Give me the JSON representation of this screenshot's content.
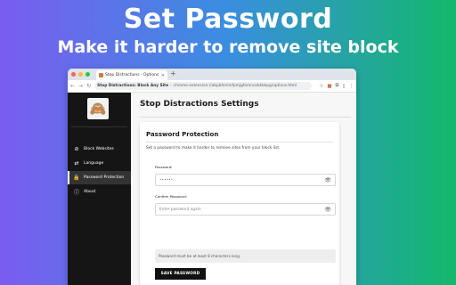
{
  "hero": {
    "title": "Set Password",
    "subtitle": "Make it harder to remove site block"
  },
  "browser": {
    "tab_title": "Stop Distractions - Options",
    "tab_close": "×",
    "new_tab": "+",
    "back": "←",
    "forward": "→",
    "reload": "↻",
    "site_name": "Stop Distractions: Block Any Site",
    "url": "chrome-extension://abpbhimlnfpmjgfomncebkbkpg/options.html",
    "colors": {
      "close": "#ff5f57",
      "minimize": "#febc2e",
      "maximize": "#28c840"
    }
  },
  "sidebar": {
    "logo": "🙈",
    "items": [
      {
        "label": "Block Websites",
        "icon": "⊘",
        "icon_name": "block-icon"
      },
      {
        "label": "Language",
        "icon": "⇄",
        "icon_name": "language-icon"
      },
      {
        "label": "Password Protection",
        "icon": "🔒",
        "icon_name": "lock-icon",
        "active": true
      },
      {
        "label": "About",
        "icon": "ⓘ",
        "icon_name": "info-icon"
      }
    ]
  },
  "main": {
    "page_title": "Stop Distractions Settings",
    "card": {
      "title": "Password Protection",
      "description": "Set a password to make it harder to remove sites from your block list.",
      "password_label": "Password:",
      "password_value": "••••••",
      "confirm_label": "Confirm Password:",
      "confirm_placeholder": "Enter password again",
      "hint": "Password must be at least 8 characters long.",
      "save_label": "SAVE PASSWORD",
      "eye_icon": "👁"
    }
  }
}
